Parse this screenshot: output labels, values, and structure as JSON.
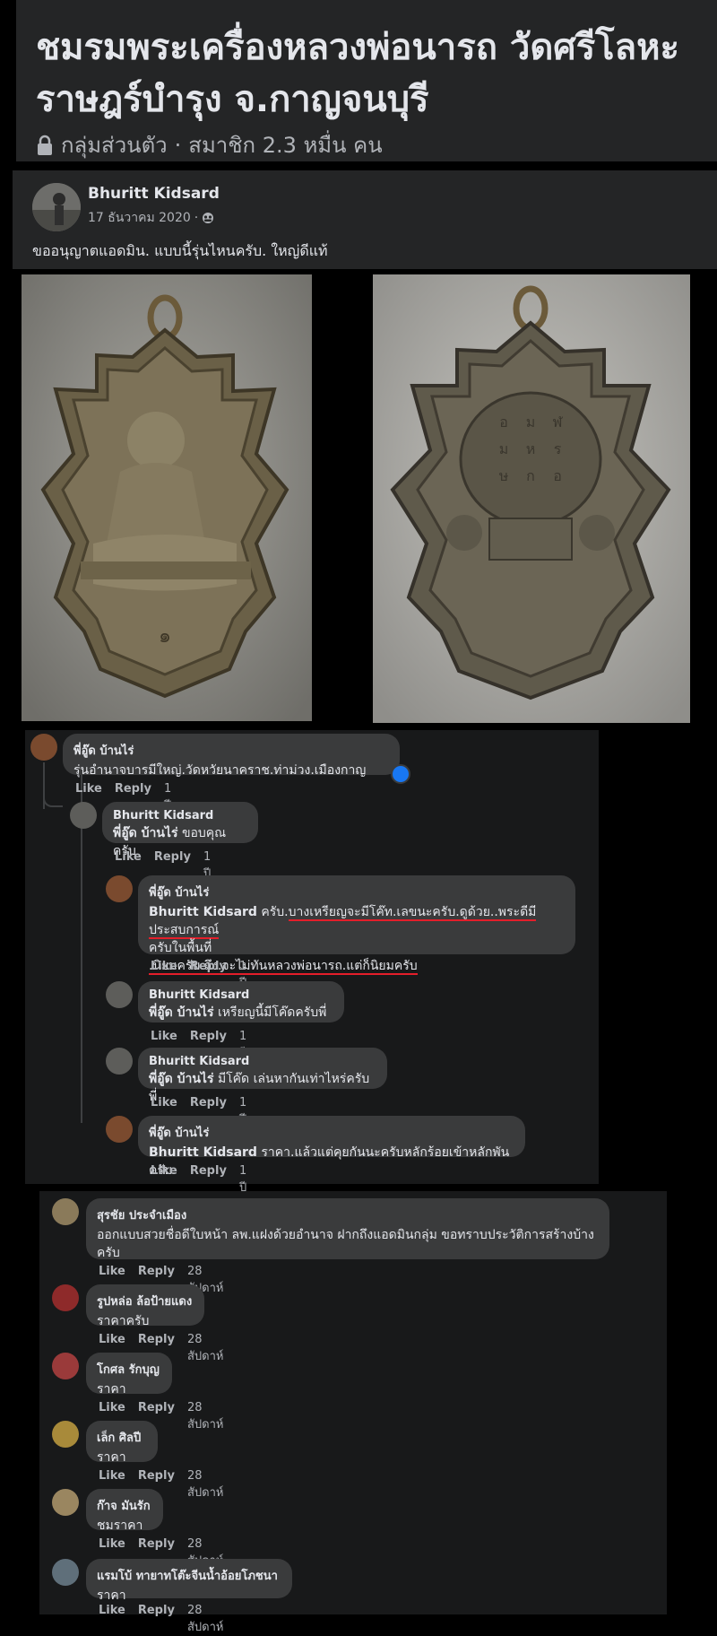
{
  "group": {
    "title": "ชมรมพระเครื่องหลวงพ่อนารถ วัดศรีโลหะราษฎร์บำรุง จ.กาญจนบุรี",
    "privacy": "กลุ่มส่วนตัว",
    "separator": "·",
    "members": "สมาชิก 2.3 หมื่น คน"
  },
  "post": {
    "author": "Bhuritt Kidsard",
    "date": "17 ธันวาคม 2020",
    "date_sep": "·",
    "text": "ขออนุญาตแอดมิน. แบบนี้รุ่นไหนครับ. ใหญ่ดีแท้"
  },
  "actions": {
    "like": "Like",
    "reply": "Reply"
  },
  "thread1": [
    {
      "name": "พี่อู๊ด บ้านไร่",
      "text": "รุ่นอำนาจบารมีใหญ่.วัดหวัยนาคราช.ท่าม่วง.เมืองกาญ",
      "time": "1 ปี"
    },
    {
      "name": "Bhuritt Kidsard",
      "mention": "พี่อู๊ด บ้านไร่",
      "text": "ขอบคุณครับ",
      "time": "1 ปี"
    },
    {
      "name": "พี่อู๊ด บ้านไร่",
      "mention": "Bhuritt Kidsard",
      "text_a": "ครับ.",
      "text_b": "บางเหรียญจะมีโค๊ท.เลขนะครับ.ดูด้วย..พระดีมีประสบการณ์",
      "text_c": "ครับในพื้นที่",
      "text_d": ".นิยมครับ.ถึง.จะไม่ทันหลวงพ่อนารถ.แต่ก็นิยมครับ",
      "time": "1 ปี"
    },
    {
      "name": "Bhuritt Kidsard",
      "mention": "พี่อู๊ด บ้านไร่",
      "text": "เหรียญนี้มีโค๊ดครับพี่",
      "time": "1 ปี"
    },
    {
      "name": "Bhuritt Kidsard",
      "mention": "พี่อู๊ด บ้านไร่",
      "text": "มีโค๊ด เล่นหากันเท่าไหร่ครับพี่",
      "time": "1 ปี"
    },
    {
      "name": "พี่อู๊ด บ้านไร่",
      "mention": "Bhuritt Kidsard",
      "text": "ราคา.แล้วแต่คุยกันนะครับหลักร้อยเข้าหลักพันครับ.",
      "time": "1 ปี"
    }
  ],
  "thread2": [
    {
      "name": "สุรชัย ประจำเมือง",
      "text": "ออกแบบสวยชื่อดีใบหน้า ลพ.แฝงด้วยอำนาจ ฝากถึงแอดมินกลุ่ม ขอทราบประวัติการสร้างบ้างครับ",
      "time": "28 สัปดาห์"
    },
    {
      "name": "รูปหล่อ ล้อป้ายแดง",
      "text": "ราคาครับ",
      "time": "28 สัปดาห์"
    },
    {
      "name": "โกศล รักบุญ",
      "text": "ราคา",
      "time": "28 สัปดาห์"
    },
    {
      "name": "เล็ก ศิลปี",
      "text": "ราคา",
      "time": "28 สัปดาห์"
    },
    {
      "name": "ก๊าจ มันรัก",
      "text": "ชมราคา",
      "time": "28 สัปดาห์"
    },
    {
      "name": "แรมโบ้ ทายาทโต๊ะจีนน้ำอ้อยโภชนา",
      "text": "ราคา",
      "time": "28 สัปดาห์"
    }
  ],
  "colors": {
    "background": "#000000",
    "panel": "#242526",
    "bubble": "#3a3b3c",
    "muted": "#b0b3b8",
    "text": "#e4e6eb",
    "underline": "#e41e2a",
    "reaction": "#1877f2"
  }
}
